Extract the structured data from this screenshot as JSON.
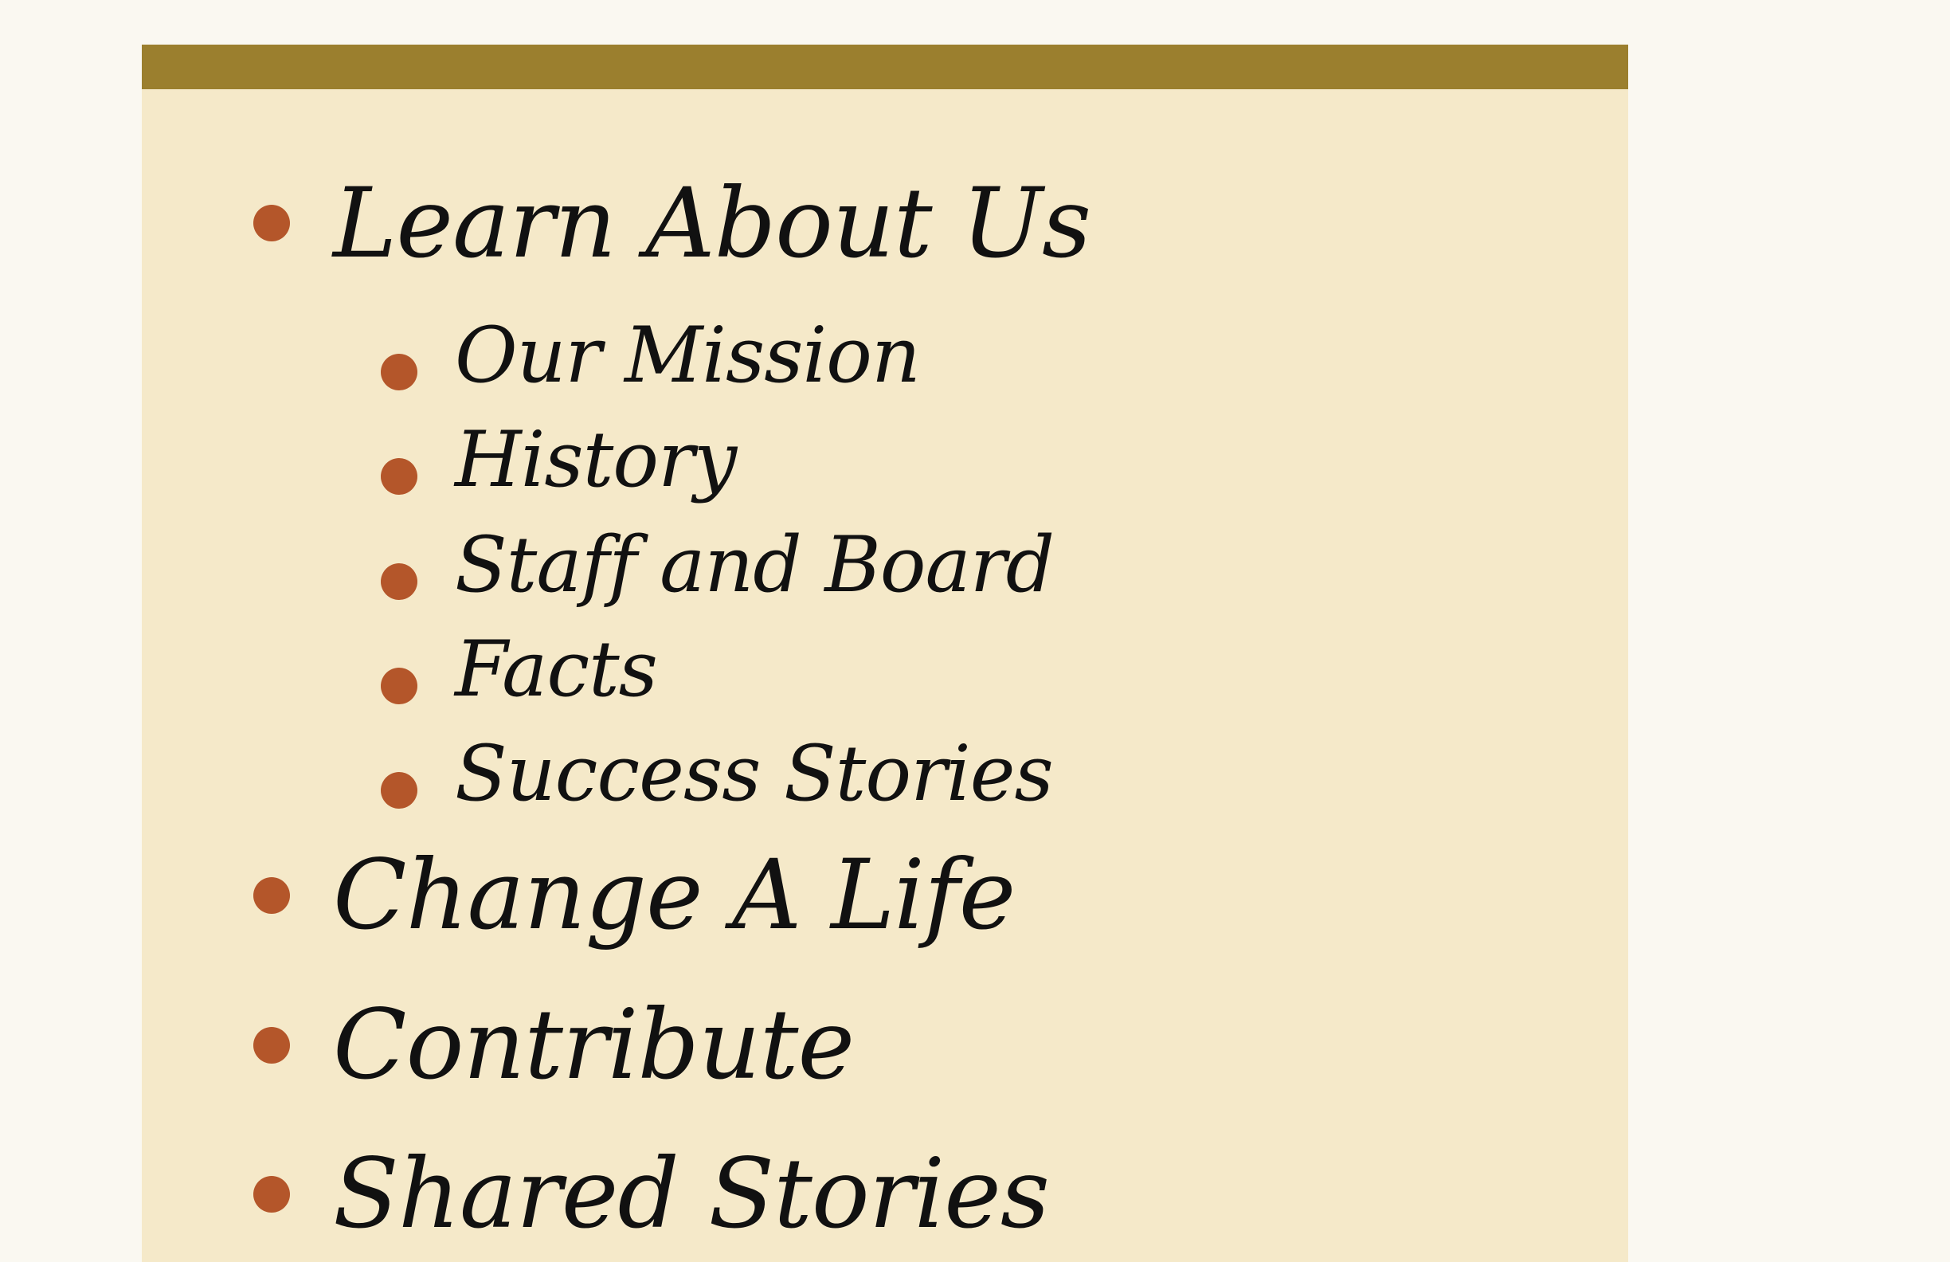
{
  "nav": {
    "items": [
      {
        "label": "Learn About Us",
        "children": [
          {
            "label": "Our Mission"
          },
          {
            "label": "History"
          },
          {
            "label": "Staff and Board"
          },
          {
            "label": "Facts"
          },
          {
            "label": "Success Stories"
          }
        ]
      },
      {
        "label": "Change A Life"
      },
      {
        "label": "Contribute"
      },
      {
        "label": "Shared Stories"
      }
    ]
  },
  "colors": {
    "page_background": "#faf8f1",
    "panel_background": "#f5e9c9",
    "header_bar": "#9b7f2e",
    "bullet": "#b4562a",
    "text": "#111111"
  }
}
